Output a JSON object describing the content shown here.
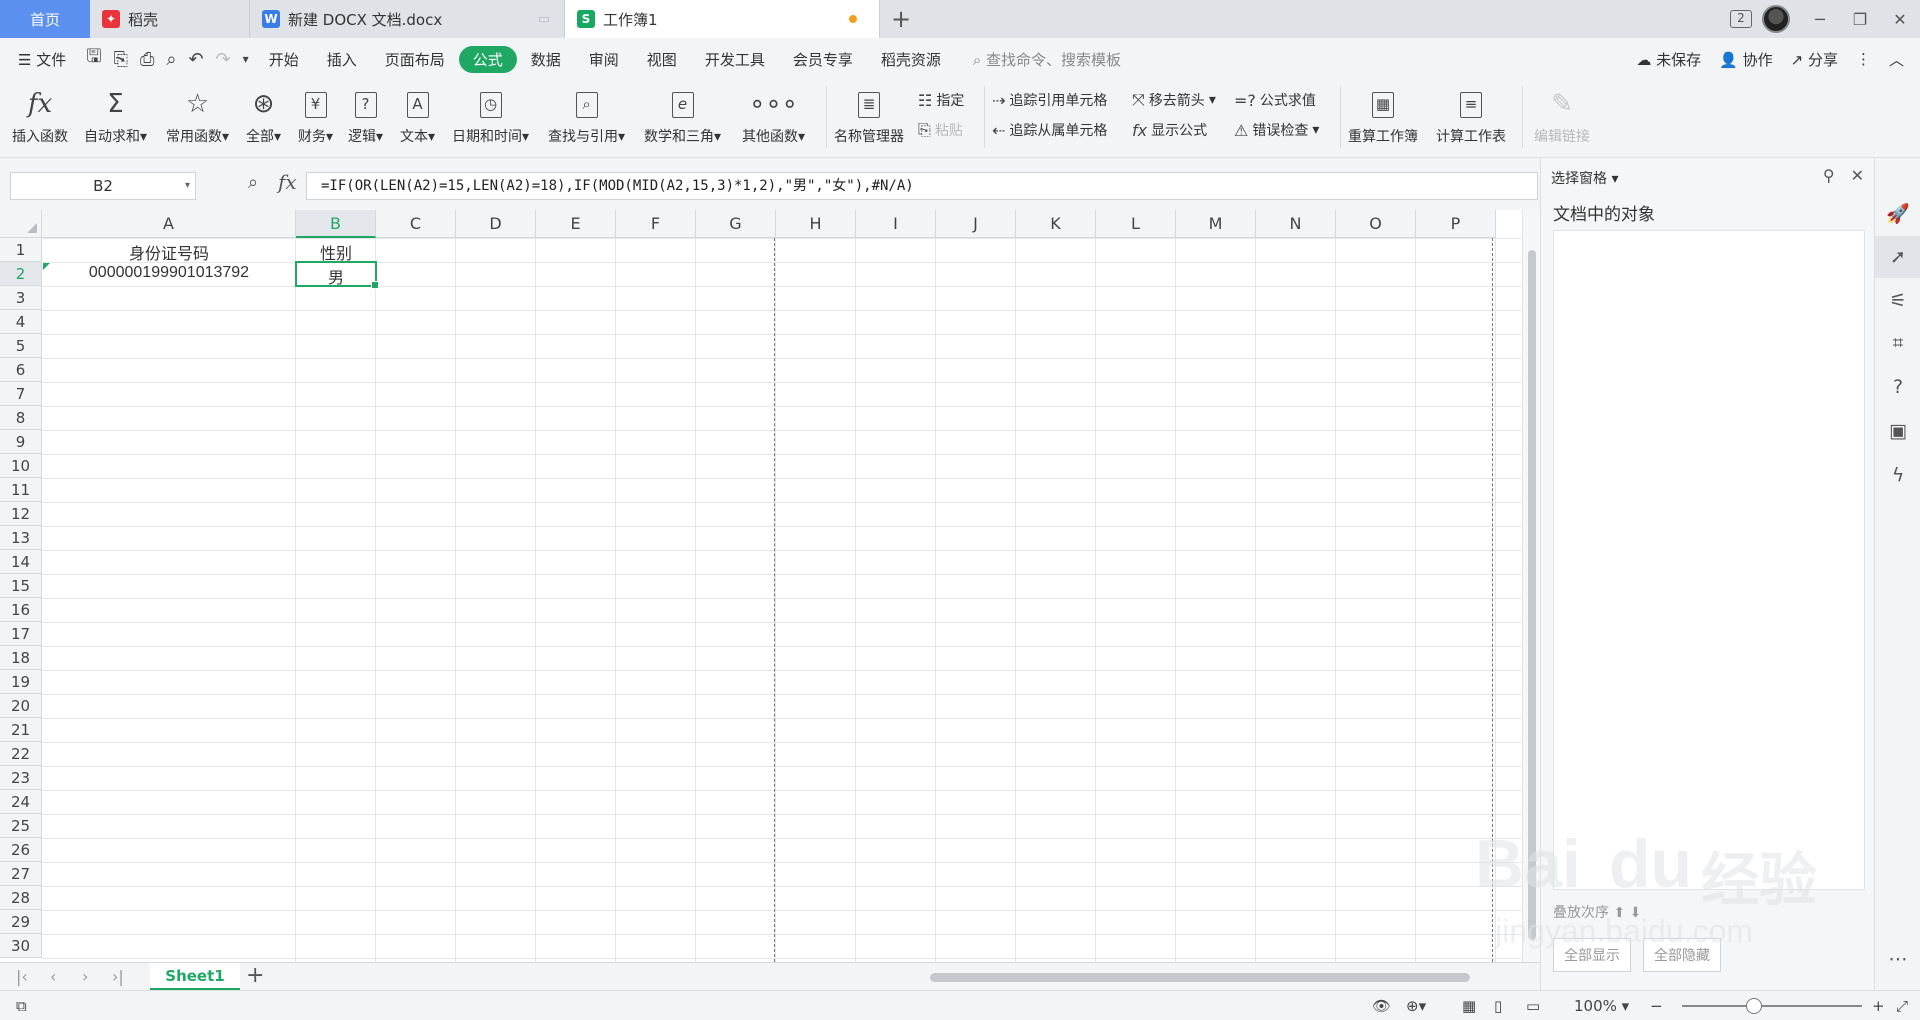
{
  "tabs": {
    "home": "首页",
    "daoke": "稻壳",
    "doc": "新建 DOCX 文档.docx",
    "workbook": "工作簿1",
    "badge": "2"
  },
  "menu": {
    "file": "文件",
    "items": [
      "开始",
      "插入",
      "页面布局",
      "公式",
      "数据",
      "审阅",
      "视图",
      "开发工具",
      "会员专享",
      "稻壳资源"
    ],
    "active": "公式",
    "search": "查找命令、搜索模板",
    "unsaved": "未保存",
    "collab": "协作",
    "share": "分享"
  },
  "ribbon": {
    "insert_fn": "插入函数",
    "autosum": "自动求和",
    "common_fn": "常用函数",
    "all": "全部",
    "finance": "财务",
    "logic": "逻辑",
    "text": "文本",
    "datetime": "日期和时间",
    "lookup": "查找与引用",
    "math": "数学和三角",
    "other_fn": "其他函数",
    "name_mgr": "名称管理器",
    "assign": "指定",
    "paste": "粘贴",
    "trace_prec": "追踪引用单元格",
    "trace_dep": "追踪从属单元格",
    "remove_arrows": "移去箭头",
    "show_formula": "显示公式",
    "eval_formula": "公式求值",
    "error_check": "错误检查",
    "recalc_book": "重算工作簿",
    "calc_sheet": "计算工作表",
    "edit_links": "编辑链接"
  },
  "formula_bar": {
    "cell_ref": "B2",
    "fx": "fx",
    "formula": "=IF(OR(LEN(A2)=15,LEN(A2)=18),IF(MOD(MID(A2,15,3)*1,2),\"男\",\"女\"),#N/A)"
  },
  "grid": {
    "columns": [
      "A",
      "B",
      "C",
      "D",
      "E",
      "F",
      "G",
      "H",
      "I",
      "J",
      "K",
      "L",
      "M",
      "N",
      "O",
      "P"
    ],
    "rows": [
      "1",
      "2",
      "3",
      "4",
      "5",
      "6",
      "7",
      "8",
      "9",
      "10",
      "11",
      "12",
      "13",
      "14",
      "15",
      "16",
      "17",
      "18",
      "19",
      "20",
      "21",
      "22",
      "23",
      "24",
      "25",
      "26",
      "27",
      "28",
      "29",
      "30"
    ],
    "selected_column": "B",
    "selected_row": "2",
    "cells": {
      "A1": "身份证号码",
      "B1": "性别",
      "A2": "000000199901013792",
      "B2": "男"
    }
  },
  "sheets": [
    "Sheet1"
  ],
  "status": {
    "zoom": "100%"
  },
  "pane": {
    "title": "选择窗格",
    "subtitle": "文档中的对象",
    "order": "叠放次序",
    "show_all": "全部显示",
    "hide_all": "全部隐藏"
  },
  "watermark": {
    "logo": "Bai",
    "logo2": "du",
    "cn": "经验",
    "url": "jingyan.baidu.com"
  },
  "colors": {
    "accent": "#1fa864",
    "home_tab": "#5b8ff0"
  }
}
